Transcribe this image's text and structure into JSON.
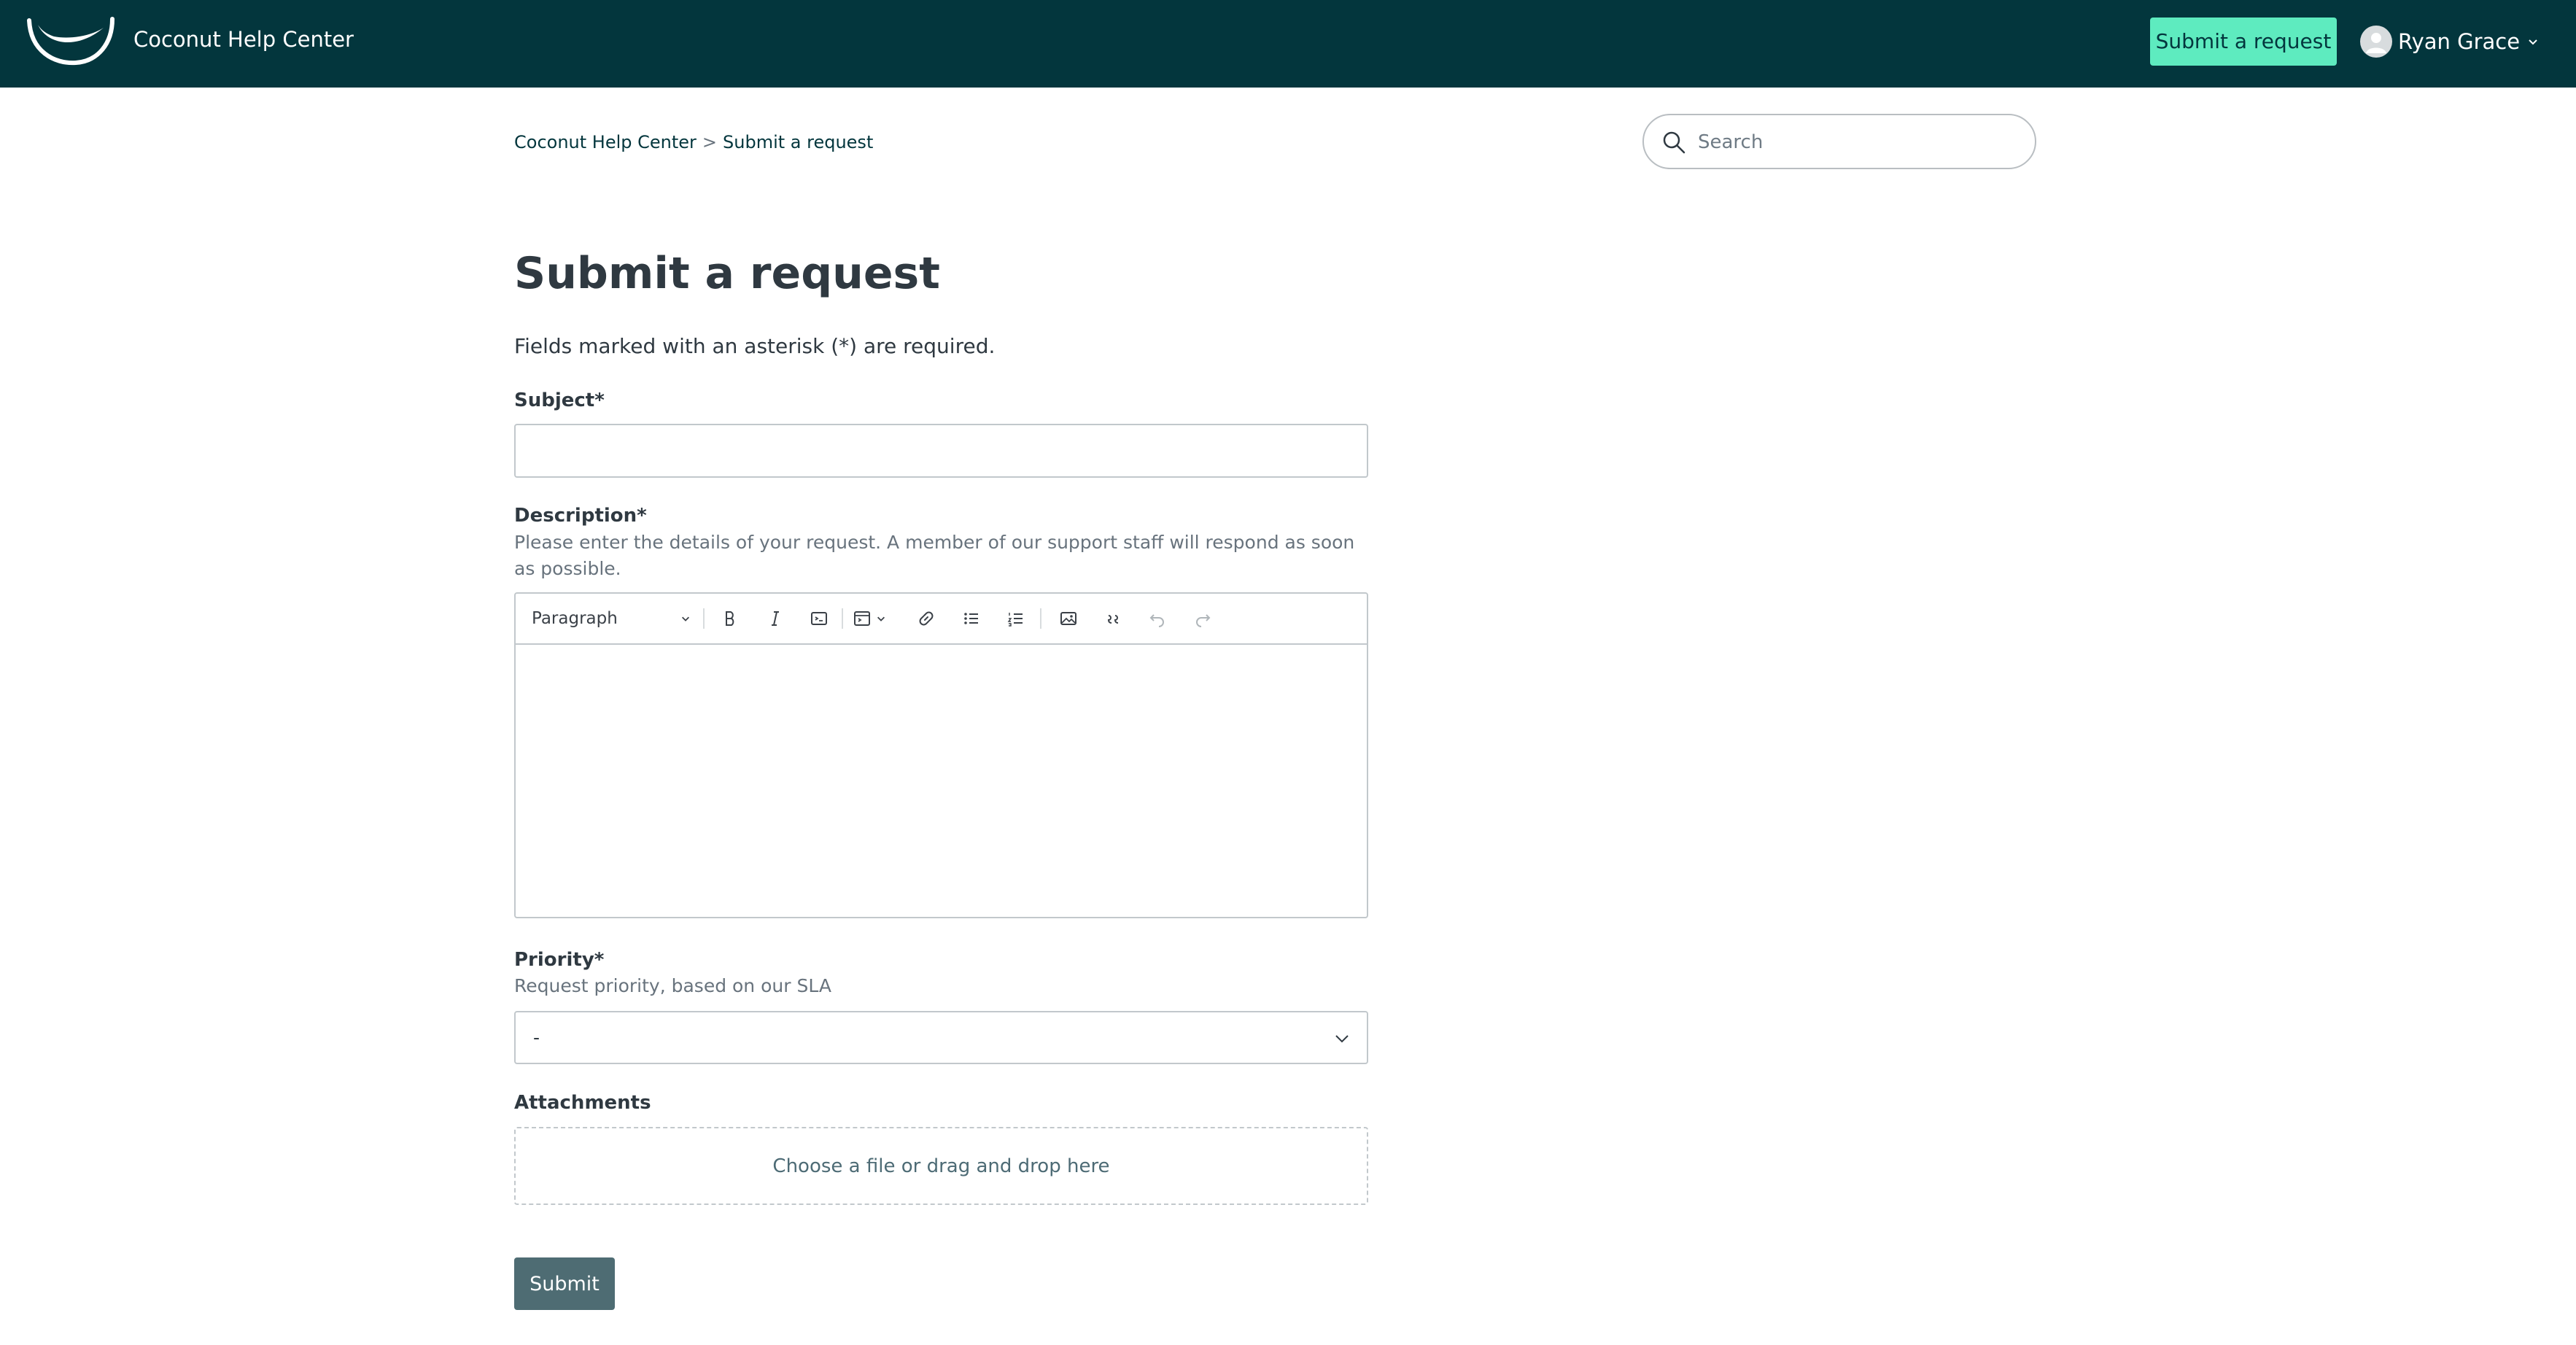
{
  "header": {
    "brand": "Coconut Help Center",
    "submit_request_label": "Submit a request",
    "user_name": "Ryan Grace",
    "logo_icon": "coconut-logo-icon",
    "user_menu_icon": "chevron-down-icon"
  },
  "breadcrumb": {
    "items": [
      "Coconut Help Center",
      "Submit a request"
    ],
    "separator": ">"
  },
  "search": {
    "placeholder": "Search",
    "icon": "search-icon"
  },
  "page": {
    "title": "Submit a request",
    "required_note": "Fields marked with an asterisk (*) are required."
  },
  "form": {
    "subject": {
      "label": "Subject*",
      "value": ""
    },
    "description": {
      "label": "Description*",
      "hint": "Please enter the details of your request. A member of our support staff will respond as soon as possible.",
      "toolbar": {
        "paragraph_label": "Paragraph",
        "buttons": [
          "bold",
          "italic",
          "code",
          "code-block",
          "link",
          "bulleted-list",
          "numbered-list",
          "image",
          "blockquote",
          "undo",
          "redo"
        ]
      }
    },
    "priority": {
      "label": "Priority*",
      "hint": "Request priority, based on our SLA",
      "selected": "-"
    },
    "attachments": {
      "label": "Attachments",
      "dropzone_text": "Choose a file or drag and drop here"
    },
    "submit_label": "Submit"
  },
  "colors": {
    "header_bg": "#03363d",
    "accent_button": "#5eebbf",
    "submit_button": "#4e6c73",
    "text": "#2f3941"
  }
}
